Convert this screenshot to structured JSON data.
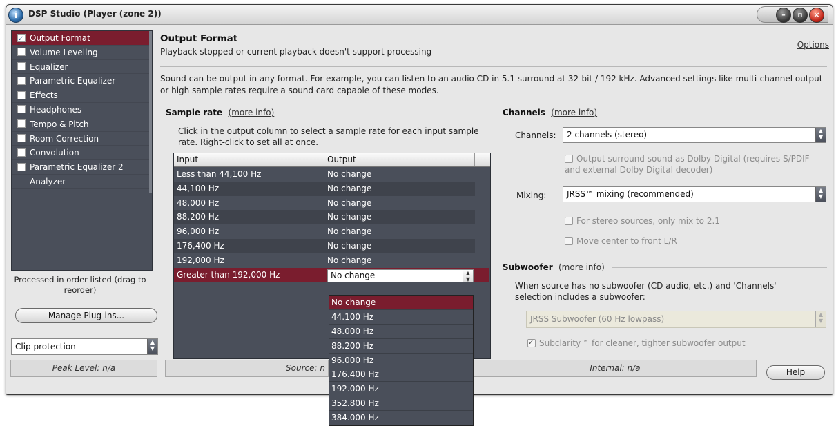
{
  "window": {
    "title": "DSP Studio (Player (zone 2))"
  },
  "sidebar": {
    "items": [
      {
        "label": "Output Format",
        "checked": true,
        "selected": true
      },
      {
        "label": "Volume Leveling",
        "checked": false
      },
      {
        "label": "Equalizer",
        "checked": false
      },
      {
        "label": "Parametric Equalizer",
        "checked": false
      },
      {
        "label": "Effects",
        "checked": false
      },
      {
        "label": "Headphones",
        "checked": false
      },
      {
        "label": "Tempo & Pitch",
        "checked": false
      },
      {
        "label": "Room Correction",
        "checked": false
      },
      {
        "label": "Convolution",
        "checked": false
      },
      {
        "label": "Parametric Equalizer 2",
        "checked": false
      },
      {
        "label": "Analyzer",
        "checked": null
      }
    ],
    "processed_note": "Processed in order listed (drag to reorder)",
    "manage_button": "Manage Plug-ins...",
    "clip_select": "Clip protection"
  },
  "status": {
    "peak": "Peak Level: n/a",
    "source": "Source: n",
    "internal": "Internal: n/a",
    "help_button": "Help"
  },
  "main": {
    "title": "Output Format",
    "subtitle": "Playback stopped or current playback doesn't support processing",
    "options_link": "Options",
    "description": "Sound can be output in any format.  For example, you can listen to an audio CD in 5.1 surround at 32-bit / 192 kHz.  Advanced settings like multi-channel output or high sample rates require a sound card capable of these modes."
  },
  "sample_rate": {
    "heading": "Sample rate",
    "more_info": "(more info)",
    "instructions": "Click in the output column to select a sample rate for each input sample rate.  Right-click to set all at once.",
    "columns": [
      "Input",
      "Output"
    ],
    "rows": [
      {
        "input": "Less than 44,100 Hz",
        "output": "No change"
      },
      {
        "input": "44,100 Hz",
        "output": "No change"
      },
      {
        "input": "48,000 Hz",
        "output": "No change"
      },
      {
        "input": "88,200 Hz",
        "output": "No change"
      },
      {
        "input": "96,000 Hz",
        "output": "No change"
      },
      {
        "input": "176,400 Hz",
        "output": "No change"
      },
      {
        "input": "192,000 Hz",
        "output": "No change"
      },
      {
        "input": "Greater than 192,000 Hz",
        "output": "No change"
      }
    ],
    "dropdown_options": [
      "No change",
      "44.100 Hz",
      "48.000 Hz",
      "88.200 Hz",
      "96.000 Hz",
      "176.400 Hz",
      "192.000 Hz",
      "352.800 Hz",
      "384.000 Hz"
    ]
  },
  "channels": {
    "heading": "Channels",
    "more_info": "(more info)",
    "channels_label": "Channels:",
    "channels_value": "2 channels (stereo)",
    "dolby_text": "Output surround sound as Dolby Digital (requires S/PDIF and external Dolby Digital decoder)",
    "mixing_label": "Mixing:",
    "mixing_value": "JRSS™ mixing (recommended)",
    "stereo_text": "For stereo sources, only mix to 2.1",
    "center_text": "Move center to front L/R"
  },
  "subwoofer": {
    "heading": "Subwoofer",
    "more_info": "(more info)",
    "description": "When source has no subwoofer (CD audio, etc.) and 'Channels' selection includes a subwoofer:",
    "select_value": "JRSS Subwoofer (60 Hz lowpass)",
    "subclarity_text": "Subclarity™ for cleaner, tighter subwoofer output"
  }
}
